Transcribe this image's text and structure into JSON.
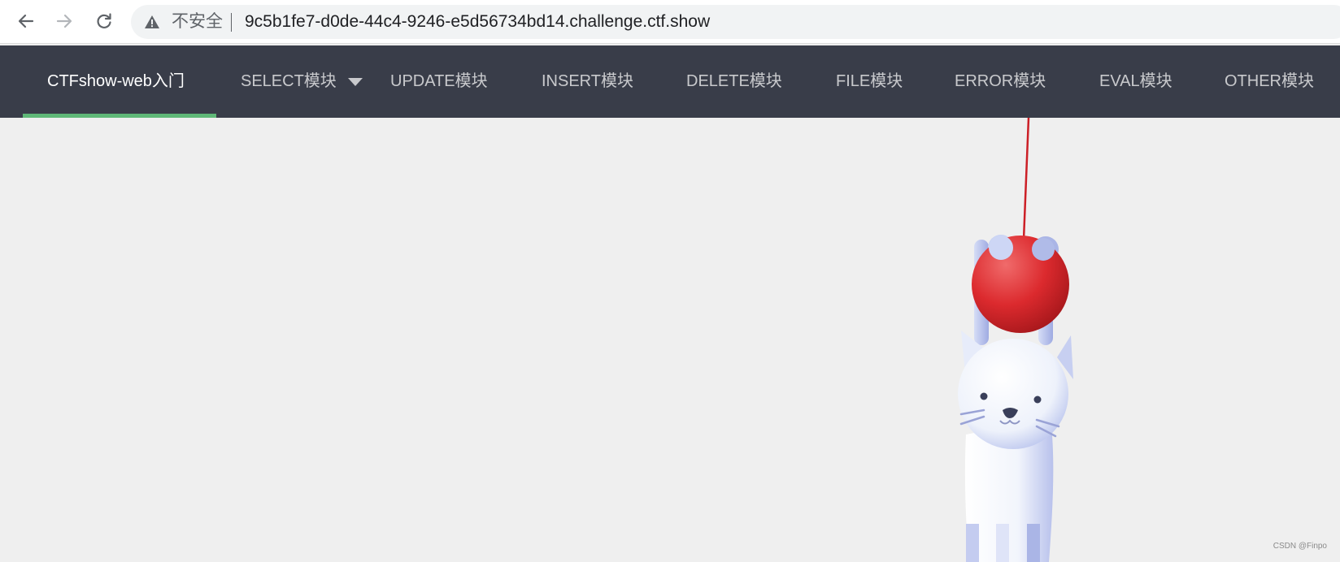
{
  "browser": {
    "security_label": "不安全",
    "url": "9c5b1fe7-d0de-44c4-9246-e5d56734bd14.challenge.ctf.show",
    "back_icon": "arrow-left-icon",
    "forward_icon": "arrow-right-icon",
    "reload_icon": "reload-icon",
    "warning_icon": "warning-triangle-icon"
  },
  "nav": {
    "items": [
      {
        "label": "CTFshow-web入门",
        "active": true
      },
      {
        "label": "SELECT模块",
        "dropdown": true
      },
      {
        "label": "UPDATE模块"
      },
      {
        "label": "INSERT模块"
      },
      {
        "label": "DELETE模块"
      },
      {
        "label": "FILE模块"
      },
      {
        "label": "ERROR模块"
      },
      {
        "label": "EVAL模块"
      },
      {
        "label": "OTHER模块"
      }
    ],
    "active_color": "#5fb878",
    "background": "#393d49"
  },
  "page": {
    "background": "#efefef",
    "illustration": "cat-hanging-from-red-ball",
    "watermark": "CSDN @Finpo"
  }
}
